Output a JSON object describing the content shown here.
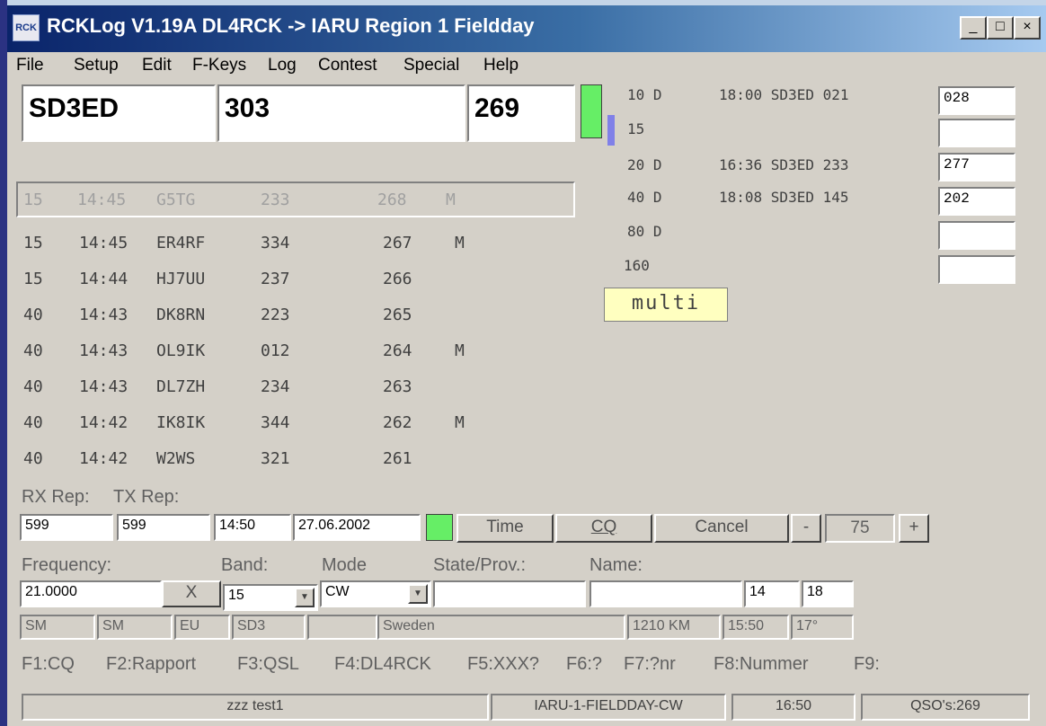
{
  "window": {
    "icon_text": "RCK",
    "title": "RCKLog V1.19A DL4RCK -> IARU Region 1 Fieldday",
    "buttons": {
      "minimize": "_",
      "maximize": "□",
      "close": "×"
    }
  },
  "menu": [
    "File",
    "Setup",
    "Edit",
    "F-Keys",
    "Log",
    "Contest",
    "Special",
    "Help"
  ],
  "entry": {
    "call": "SD3ED",
    "rcvd": "303",
    "sent": "269"
  },
  "indicators": {
    "green": "#66ee66",
    "blue": "#8080e8"
  },
  "last_qso": {
    "band": "15",
    "time": "14:45",
    "call": "G5TG",
    "rcvd": "233",
    "nr": "268",
    "mult": "M"
  },
  "log": [
    {
      "band": "15",
      "time": "14:45",
      "call": "ER4RF",
      "rcvd": "334",
      "nr": "267",
      "mult": "M"
    },
    {
      "band": "15",
      "time": "14:44",
      "call": "HJ7UU",
      "rcvd": "237",
      "nr": "266",
      "mult": ""
    },
    {
      "band": "40",
      "time": "14:43",
      "call": "DK8RN",
      "rcvd": "223",
      "nr": "265",
      "mult": ""
    },
    {
      "band": "40",
      "time": "14:43",
      "call": "OL9IK",
      "rcvd": "012",
      "nr": "264",
      "mult": "M"
    },
    {
      "band": "40",
      "time": "14:43",
      "call": "DL7ZH",
      "rcvd": "234",
      "nr": "263",
      "mult": ""
    },
    {
      "band": "40",
      "time": "14:42",
      "call": "IK8IK",
      "rcvd": "344",
      "nr": "262",
      "mult": "M"
    },
    {
      "band": "40",
      "time": "14:42",
      "call": "W2WS",
      "rcvd": "321",
      "nr": "261",
      "mult": ""
    }
  ],
  "bands": [
    {
      "band": "10",
      "flag": "D",
      "info": "18:00 SD3ED 021",
      "box": "028"
    },
    {
      "band": "15",
      "flag": "",
      "info": "",
      "box": ""
    },
    {
      "band": "20",
      "flag": "D",
      "info": "16:36 SD3ED 233",
      "box": "277"
    },
    {
      "band": "40",
      "flag": "D",
      "info": "18:08 SD3ED 145",
      "box": "202"
    },
    {
      "band": "80",
      "flag": "D",
      "info": "",
      "box": ""
    },
    {
      "band": "160",
      "flag": "",
      "info": "",
      "box": ""
    }
  ],
  "multi_label": "multi",
  "reports": {
    "rx_label": "RX Rep:",
    "tx_label": "TX Rep:",
    "rx": "599",
    "tx": "599",
    "time": "14:50",
    "date": "27.06.2002",
    "time_button": "Time",
    "cq_button": "CQ",
    "cancel_button": "Cancel",
    "minus_button": "-",
    "plus_button": "+",
    "speed": "75"
  },
  "freq": {
    "freq_label": "Frequency:",
    "band_label": "Band:",
    "mode_label": "Mode",
    "state_label": "State/Prov.:",
    "name_label": "Name:",
    "frequency": "21.0000",
    "x_button": "X",
    "band": "15",
    "mode": "CW",
    "state": "",
    "name": "",
    "box1": "14",
    "box2": "18"
  },
  "info": {
    "pfx1": "SM",
    "pfx2": "SM",
    "cont": "EU",
    "area": "SD3",
    "blank": "",
    "country": "Sweden",
    "dist": "1210 KM",
    "local_time": "15:50",
    "bearing": "17°"
  },
  "fkeys": [
    "F1:CQ",
    "F2:Rapport",
    "F3:QSL",
    "F4:DL4RCK",
    "F5:XXX?",
    "F6:?",
    "F7:?nr",
    "F8:Nummer",
    "F9:"
  ],
  "status": {
    "text": "zzz test1",
    "contest": "IARU-1-FIELDDAY-CW",
    "time": "16:50",
    "qsos": "QSO's:269"
  }
}
